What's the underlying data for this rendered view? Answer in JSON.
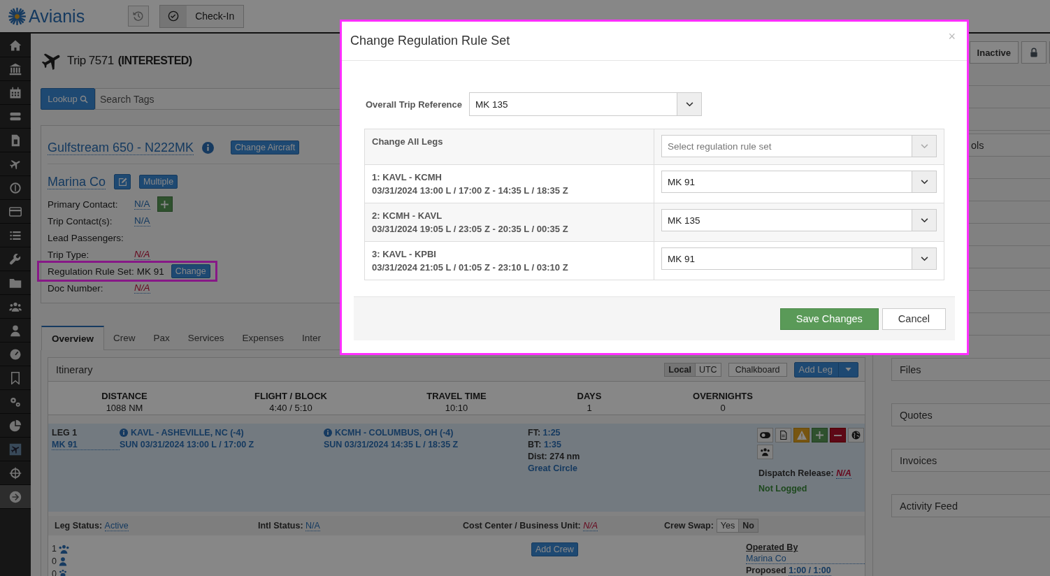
{
  "app": {
    "logo": "Avianis",
    "check_in": "Check-In",
    "status_button": "Inactive"
  },
  "trip": {
    "title": "Trip 7571",
    "status": "(INTERESTED)"
  },
  "lookup": {
    "button": "Lookup",
    "search": {
      "placeholder": "Search Tags"
    }
  },
  "aircraft": {
    "name": "Gulfstream 650 - N222MK",
    "change_button": "Change Aircraft"
  },
  "customer": {
    "name": "Marina Co",
    "multiple_button": "Multiple"
  },
  "fields": [
    {
      "label": "Primary Contact:",
      "value": "N/A",
      "kind": "link",
      "add_button": true,
      "highlighted": false
    },
    {
      "label": "Trip Contact(s):",
      "value": "N/A",
      "kind": "link",
      "add_button": false,
      "highlighted": false
    },
    {
      "label": "Lead Passengers:",
      "kind": "none",
      "add_button": false,
      "highlighted": false
    },
    {
      "label": "Trip Type:",
      "value": "N/A",
      "kind": "missing",
      "add_button": false,
      "highlighted": false
    },
    {
      "label": "Regulation Rule Set:",
      "value": "MK 91",
      "kind": "plain",
      "button": "Change",
      "add_button": false,
      "highlighted": true
    },
    {
      "label": "Doc Number:",
      "value": "N/A",
      "kind": "missing",
      "add_button": false,
      "highlighted": false
    }
  ],
  "tabs": [
    {
      "label": "Overview",
      "selected": true
    },
    {
      "label": "Crew",
      "selected": false
    },
    {
      "label": "Pax",
      "selected": false
    },
    {
      "label": "Services",
      "selected": false
    },
    {
      "label": "Expenses",
      "selected": false
    },
    {
      "label": "Inter",
      "selected": false
    }
  ],
  "itinerary": {
    "title": "Itinerary",
    "time_modes": [
      {
        "label": "Local",
        "selected": true
      },
      {
        "label": "UTC",
        "selected": false
      }
    ],
    "chalkboard": "Chalkboard",
    "add_leg": "Add Leg",
    "stats": [
      {
        "label": "DISTANCE",
        "value": "1088 NM"
      },
      {
        "label": "FLIGHT / BLOCK",
        "value": "4:40 / 5:10"
      },
      {
        "label": "TRAVEL TIME",
        "value": "10:10"
      },
      {
        "label": "DAYS",
        "value": "1"
      },
      {
        "label": "OVERNIGHTS",
        "value": "0"
      }
    ]
  },
  "legs": [
    {
      "label": "LEG 1",
      "rule_set": "MK 91",
      "departure": {
        "airport": "KAVL - ASHEVILLE, NC (-4)",
        "time": "SUN 03/31/2024 13:00 L / 17:00 Z"
      },
      "arrival": {
        "airport": "KCMH - COLUMBUS, OH (-4)",
        "time": "SUN 03/31/2024 14:35 L / 18:35 Z"
      },
      "times": [
        {
          "label": "FT:",
          "value": "1:25"
        },
        {
          "label": "BT:",
          "value": "1:35"
        }
      ],
      "distance": "Dist: 274 nm",
      "route_link": "Great Circle",
      "dispatch": {
        "label": "Dispatch Release:",
        "value": "N/A"
      },
      "log_status": "Not Logged",
      "status_items": [
        {
          "label": "Leg Status:",
          "value": "Active",
          "kind": "link"
        },
        {
          "label": "Intl Status:",
          "value": "N/A",
          "kind": "link"
        },
        {
          "label": "Cost Center / Business Unit:",
          "value": "N/A",
          "kind": "missing"
        }
      ],
      "crew_swap": {
        "label": "Crew Swap:",
        "options": [
          {
            "label": "Yes",
            "selected": false
          },
          {
            "label": "No",
            "selected": true
          }
        ]
      },
      "counts": [
        "1",
        "0",
        "0"
      ],
      "add_crew": "Add Crew",
      "operated_by": {
        "label": "Operated By",
        "value": "Marina Co"
      },
      "proposed": {
        "label": "Proposed",
        "value": "1:00 / 1:00"
      }
    }
  ],
  "right_panels": [
    {
      "title": "ols"
    },
    {
      "title": "Files"
    },
    {
      "title": "Quotes"
    },
    {
      "title": "Invoices"
    },
    {
      "title": "Activity Feed"
    }
  ],
  "modal": {
    "title": "Change Regulation Rule Set",
    "close": "×",
    "overall": {
      "label": "Overall Trip Reference",
      "value": "MK 135"
    },
    "change_all": {
      "label": "Change All Legs",
      "placeholder": "Select regulation rule set"
    },
    "legs": [
      {
        "route": "1: KAVL - KCMH",
        "times": "03/31/2024 13:00 L / 17:00 Z - 14:35 L / 18:35 Z",
        "value": "MK 91"
      },
      {
        "route": "2: KCMH - KAVL",
        "times": "03/31/2024 19:05 L / 23:05 Z - 20:35 L / 00:35 Z",
        "value": "MK 135"
      },
      {
        "route": "3: KAVL - KPBI",
        "times": "03/31/2024 21:05 L / 01:05 Z - 23:10 L / 03:10 Z",
        "value": "MK 91"
      }
    ],
    "save": "Save Changes",
    "cancel": "Cancel"
  }
}
